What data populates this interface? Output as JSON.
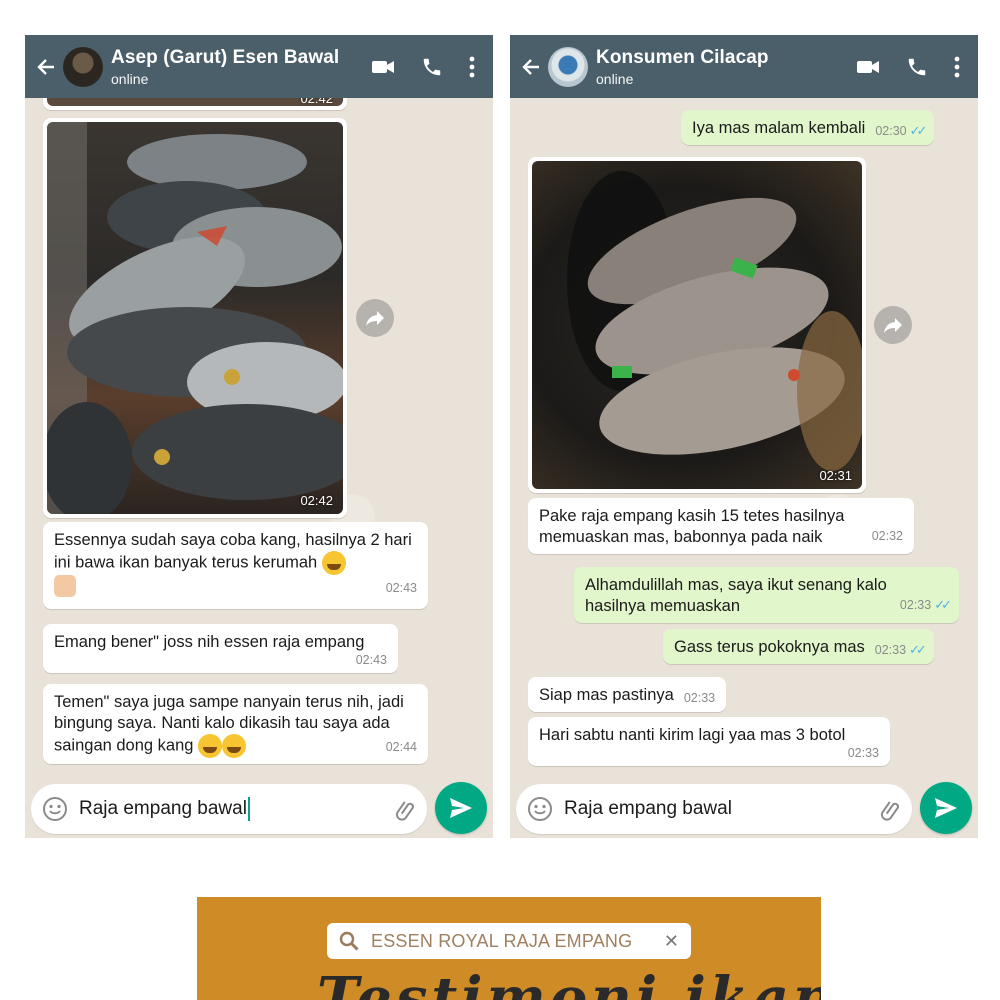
{
  "left_chat": {
    "contact_name": "Asep (Garut) Esen Bawal",
    "status": "online",
    "prev_time": "02:42",
    "image_time": "02:42",
    "messages": [
      {
        "text": "Essennya sudah saya coba kang, hasilnya 2 hari ini bawa ikan banyak terus kerumah",
        "time": "02:43"
      },
      {
        "text": "Emang bener\" joss nih essen raja empang",
        "time": "02:43"
      },
      {
        "text": "Temen\" saya juga sampe nanyain terus nih, jadi bingung saya. Nanti kalo dikasih tau saya ada saingan dong kang",
        "time": "02:44"
      }
    ],
    "input_text": "Raja empang bawal"
  },
  "right_chat": {
    "contact_name": "Konsumen Cilacap",
    "status": "online",
    "messages_top": [
      {
        "text": "Iya mas malam kembali",
        "time": "02:30"
      }
    ],
    "image_time": "02:31",
    "messages": [
      {
        "text": "Pake raja empang kasih 15 tetes hasilnya memuaskan mas, babonnya pada naik",
        "time": "02:32"
      },
      {
        "text": "Alhamdulillah mas, saya ikut senang kalo hasilnya memuaskan",
        "time": "02:33"
      },
      {
        "text": "Gass terus pokoknya mas",
        "time": "02:33"
      },
      {
        "text": "Siap mas pastinya",
        "time": "02:33"
      },
      {
        "text": "Hari sabtu nanti kirim lagi yaa mas 3 botol",
        "time": "02:33"
      }
    ],
    "input_text": "Raja empang bawal"
  },
  "banner": {
    "search_text": "ESSEN ROYAL RAJA EMPANG",
    "title": "Testimoni ikan",
    "color": "#cf8b26"
  },
  "colors": {
    "header": "#4a5f69",
    "send": "#00a884",
    "outgoing": "#e1f7cb"
  }
}
